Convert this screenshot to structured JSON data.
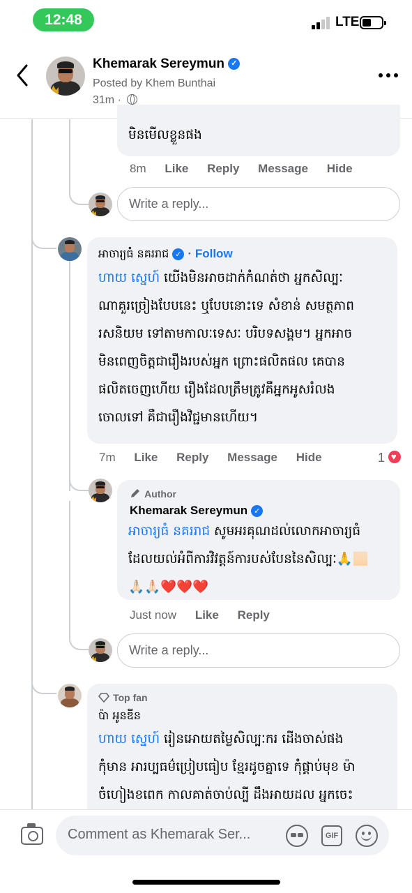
{
  "status_bar": {
    "time": "12:48",
    "network": "LTE",
    "battery_level": 0.45
  },
  "header": {
    "back_icon": "chevron-left-icon",
    "name": "Khemarak Sereymun",
    "posted_by": "Posted by Khem Bunthai",
    "time": "31m",
    "more_icon": "ellipsis-icon"
  },
  "thread": {
    "prev_reply": {
      "text": "មិនមើលខ្លួនផង",
      "time": "8m",
      "actions": [
        "Like",
        "Reply",
        "Message",
        "Hide"
      ]
    },
    "reply_box_1": {
      "placeholder": "Write a reply..."
    },
    "comment_1": {
      "name": "អាចារ្យធំ នគររាជ",
      "follow": "Follow",
      "mention": "ហាយ ស្នេហ៍",
      "lines": [
        " យើងមិនអាចដាក់កំណត់ថា អ្នកសិល្បៈ",
        "ណាគួរច្រៀងបែបនេះ ឬបែបនោះទេ សំខាន់ សមត្ថភាព",
        "រសនិយម ទៅតាមកាលៈទេសៈ បរិបទសង្គម។ អ្នកអាច",
        "មិនពេញចិត្តជារឿងរបស់អ្នក ព្រោះផលិតផល គេបាន",
        "ផលិតចេញហើយ រឿងដែលត្រឹមត្រូវគឺអ្នកអូសរំលង",
        "ចោលទៅ គឺជារឿងវិជ្ជមានហើយ។"
      ],
      "time": "7m",
      "actions": [
        "Like",
        "Reply",
        "Message",
        "Hide"
      ],
      "reaction_count": "1"
    },
    "author_reply": {
      "badge": "Author",
      "name": "Khemarak Sereymun",
      "mention": "អាចារ្យធំ នគររាជ",
      "lines": [
        " សូមអរគុណដល់លោកអាចារ្យធំ",
        "ដែលយល់អំពីការវិវត្តន៍ការបស់បែននៃសិល្បៈ🙏🏻",
        "🙏🏻🙏🏻❤️❤️❤️"
      ],
      "time": "Just now",
      "actions": [
        "Like",
        "Reply"
      ]
    },
    "reply_box_2": {
      "placeholder": "Write a reply..."
    },
    "comment_2": {
      "badge": "Top fan",
      "name": "ប៉ា អូនឌីន",
      "mention": "ហាយ ស្នេហ៍",
      "lines": [
        " រៀនអោយតម្លៃសិល្បៈករ ដើងចាស់ផង",
        "កុំមាន អារប្បធម៌ប្រៀបធៀប ខ្មែរដូចគ្នាទេ កុំផ្គាប់មុខ ម៉ា",
        "ចំហៀងខពេក កាលគាត់ចាប់ល្បី ដឹងអាយដល អ្នកចេះ"
      ]
    }
  },
  "composer": {
    "camera_icon": "camera-icon",
    "placeholder": "Comment as Khemarak Ser...",
    "avatar_sticker_icon": "avatar-sticker-icon",
    "gif_label": "GIF",
    "emoji_icon": "emoji-icon"
  }
}
